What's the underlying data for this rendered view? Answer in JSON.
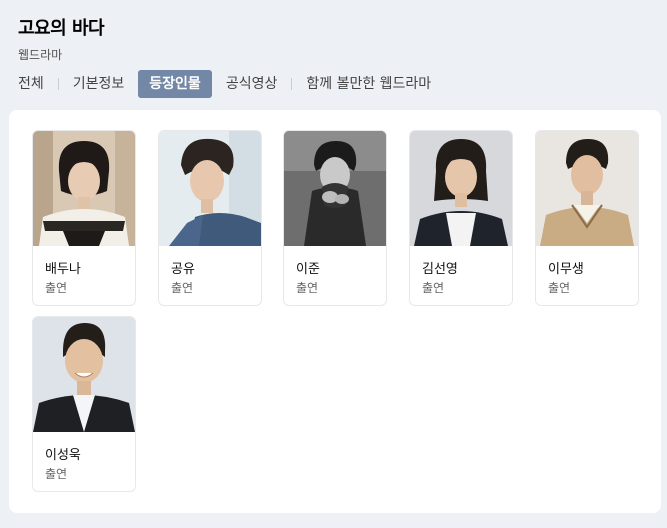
{
  "header": {
    "title": "고요의 바다",
    "subtitle": "웹드라마"
  },
  "tabs": [
    {
      "label": "전체"
    },
    {
      "label": "기본정보"
    },
    {
      "label": "등장인물",
      "active": true
    },
    {
      "label": "공식영상"
    },
    {
      "label": "함께 볼만한 웹드라마"
    }
  ],
  "cast": [
    {
      "name": "배두나",
      "role": "출연"
    },
    {
      "name": "공유",
      "role": "출연"
    },
    {
      "name": "이준",
      "role": "출연"
    },
    {
      "name": "김선영",
      "role": "출연"
    },
    {
      "name": "이무생",
      "role": "출연"
    },
    {
      "name": "이성욱",
      "role": "출연"
    }
  ],
  "colors": {
    "active_tab": "#7288a6",
    "background": "#edf0f5"
  }
}
